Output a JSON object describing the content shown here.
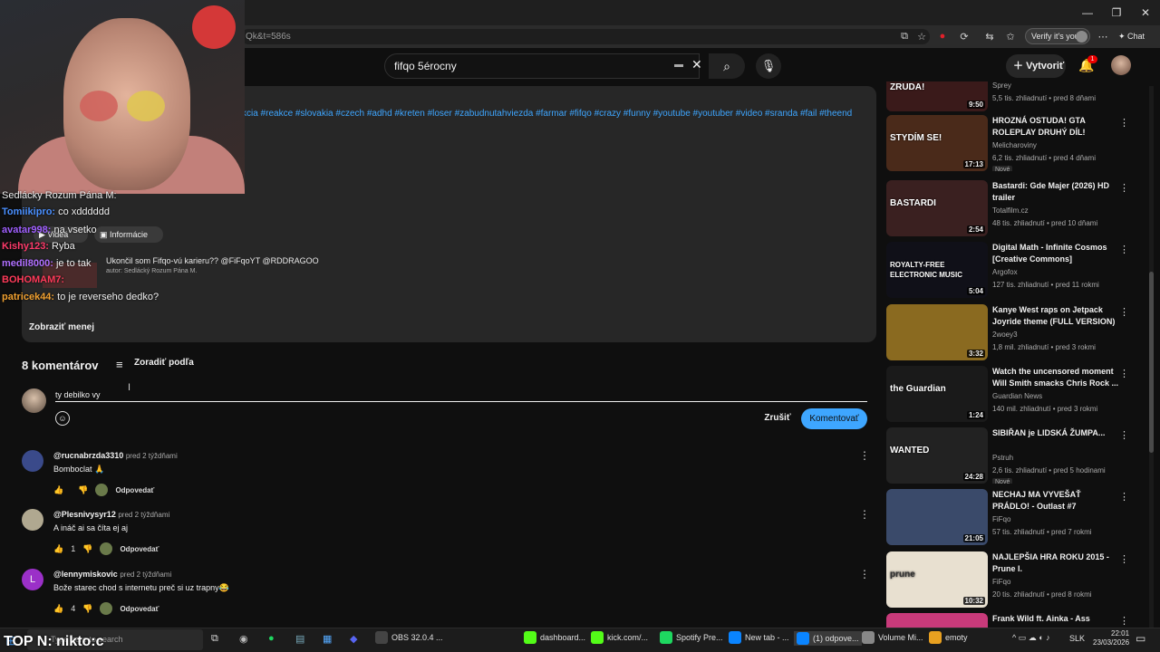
{
  "browser": {
    "url": "Qk&t=586s",
    "verify_label": "Verify it's you",
    "chat_label": "Chat"
  },
  "header": {
    "search_value": "fifqo 5érocny",
    "create_label": "Vytvoriť",
    "bell_badge": "1"
  },
  "description": {
    "tags": "kcia #reakce #slovakia #czech #adhd #kreten #loser #zabudnutahviezda #farmar #fifqo #crazy #funny #youtube #youtuber #video #sranda #fail #theend",
    "chip_videa": "Videá",
    "chip_info": "Informácie",
    "linked_title": "Ukončil som Fifqo-vú karieru?? @FiFqoYT @RDDRAGOO",
    "linked_author": "autor: Sedlácký Rozum Pána M.",
    "show_less": "Zobraziť menej"
  },
  "stream_chat": [
    {
      "name": "",
      "text": "Sedlácky Rozum Pána M:",
      "color": "#e0e0e0"
    },
    {
      "name": "Tomiikipro:",
      "text": "co xdddddd",
      "color": "#4a90ff"
    },
    {
      "name": "avatar998:",
      "text": "na vsetko",
      "color": "#a060ff"
    },
    {
      "name": "Kishy123:",
      "text": "Ryba",
      "color": "#ff3b6b"
    },
    {
      "name": "medil8000:",
      "text": "je to tak",
      "color": "#b070ff"
    },
    {
      "name": "BOHOMAM7:",
      "text": "",
      "color": "#ff3b5a"
    },
    {
      "name": "patricek44:",
      "text": "to je reverseho dedko?",
      "color": "#f0a030"
    }
  ],
  "comments": {
    "count_label": "8 komentárov",
    "sort_label": "Zoradiť podľa",
    "input_value": "ty debilko vy",
    "cancel_label": "Zrušiť",
    "submit_label": "Komentovať",
    "items": [
      {
        "handle": "@rucnabrzda3310",
        "time": "pred 2 týždňami",
        "text": "Bomboclat 🙏",
        "likes": "",
        "reply": "Odpovedať"
      },
      {
        "handle": "@Plesnivysyr12",
        "time": "pred 2 týždňami",
        "text": "A ináč ai sa číta ej aj",
        "likes": "1",
        "reply": "Odpovedať"
      },
      {
        "handle": "@lennymiskovic",
        "time": "pred 2 týždňami",
        "text": "Bože starec chod s internetu preč si uz trapny😂",
        "likes": "4",
        "reply": "Odpovedať"
      }
    ]
  },
  "sidebar": [
    {
      "title": "",
      "channel": "Sprey",
      "meta": "5,5 tis. zhliadnutí • pred 8 dňami",
      "duration": "9:50",
      "thumb_text": "ZRUDA!",
      "new": ""
    },
    {
      "title": "HROZNÁ OSTUDA! GTA ROLEPLAY DRUHÝ DÍL!",
      "channel": "Melicharoviny",
      "meta": "6,2 tis. zhliadnutí • pred 4 dňami",
      "duration": "17:13",
      "thumb_text": "STYDÍM SE!",
      "new": "Nové"
    },
    {
      "title": "Bastardi: Gde Majer (2026) HD trailer",
      "channel": "Totalfilm.cz",
      "meta": "48 tis. zhliadnutí • pred 10 dňami",
      "duration": "2:54",
      "thumb_text": "BASTARDI",
      "new": ""
    },
    {
      "title": "Digital Math - Infinite Cosmos [Creative Commons]",
      "channel": "Argofox",
      "meta": "127 tis. zhliadnutí • pred 11 rokmi",
      "duration": "5:04",
      "thumb_text": "ROYALTY-FREE ELECTRONIC MUSIC",
      "new": ""
    },
    {
      "title": "Kanye West raps on Jetpack Joyride theme (FULL VERSION)",
      "channel": "2woey3",
      "meta": "1,8 mil. zhliadnutí • pred 3 rokmi",
      "duration": "3:32",
      "thumb_text": "",
      "new": ""
    },
    {
      "title": "Watch the uncensored moment Will Smith smacks Chris Rock ...",
      "channel": "Guardian News",
      "meta": "140 mil. zhliadnutí • pred 3 rokmi",
      "duration": "1:24",
      "thumb_text": "the Guardian",
      "new": ""
    },
    {
      "title": "SIBIŘAN je LIDSKÁ ŽUMPA...",
      "channel": "Pstruh",
      "meta": "2,6 tis. zhliadnutí • pred 5 hodinami",
      "duration": "24:28",
      "thumb_text": "WANTED",
      "new": "Nové"
    },
    {
      "title": "NECHAJ MA VYVEŠAŤ PRÁDLO! - Outlast #7",
      "channel": "FiFqo",
      "meta": "57 tis. zhliadnutí • pred 7 rokmi",
      "duration": "21:05",
      "thumb_text": "",
      "new": ""
    },
    {
      "title": "NAJLEPŠIA HRA ROKU 2015 - Prune I.",
      "channel": "FiFqo",
      "meta": "20 tis. zhliadnutí • pred 8 rokmi",
      "duration": "10:32",
      "thumb_text": "prune",
      "new": ""
    },
    {
      "title": "Frank Wild ft. Ainka - Ass",
      "channel": "",
      "meta": "",
      "duration": "",
      "thumb_text": "",
      "new": ""
    }
  ],
  "taskbar": {
    "search_placeholder": "Type here to search",
    "overlay_text": "TOP N: nikto:c",
    "items": [
      "OBS 32.0.4 ...",
      "dashboard...",
      "kick.com/...",
      "Spotify Pre...",
      "New tab - ...",
      "(1) odpove...",
      "Volume Mi...",
      "emoty"
    ],
    "lang": "SLK",
    "time": "22:01",
    "date": "23/03/2026"
  },
  "colors": {
    "accent": "#3ea6ff",
    "background": "#0f0f0f",
    "panel": "#272727"
  }
}
